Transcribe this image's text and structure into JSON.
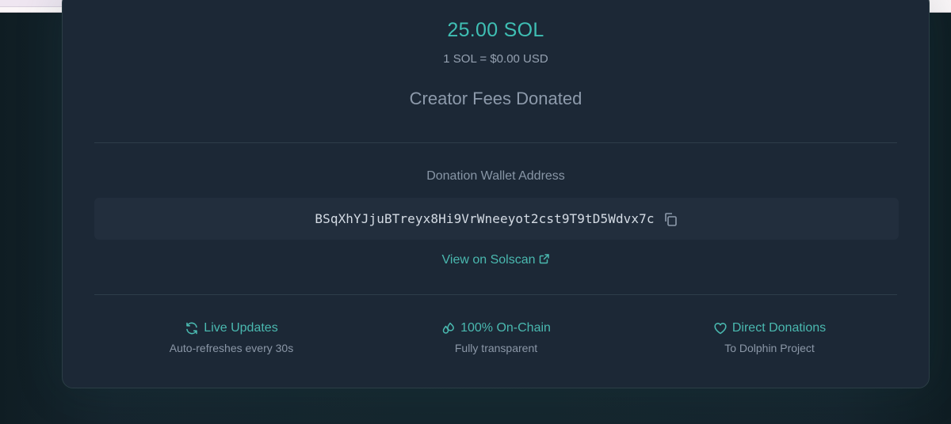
{
  "donation": {
    "amount": "25.00 SOL",
    "rate": "1 SOL = $0.00 USD",
    "label": "Creator Fees Donated"
  },
  "wallet": {
    "label": "Donation Wallet Address",
    "address": "BSqXhYJjuBTreyx8Hi9VrWneeyot2cst9T9tD5Wdvx7c",
    "copy_icon": "copy-icon",
    "solscan_label": "View on Solscan",
    "external_icon": "external-link-icon"
  },
  "features": [
    {
      "icon": "refresh-icon",
      "title": "Live Updates",
      "subtitle": "Auto-refreshes every 30s"
    },
    {
      "icon": "droplets-icon",
      "title": "100% On-Chain",
      "subtitle": "Fully transparent"
    },
    {
      "icon": "heart-icon",
      "title": "Direct Donations",
      "subtitle": "To Dolphin Project"
    }
  ],
  "colors": {
    "accent": "#4ab9b0",
    "card_background": "#1c2836",
    "page_background": "#15222b",
    "muted_text": "#8d9aab"
  }
}
